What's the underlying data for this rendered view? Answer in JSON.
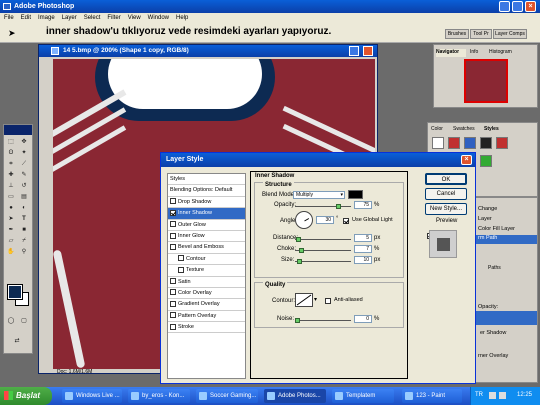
{
  "app": {
    "title": "Adobe Photoshop",
    "menu": [
      "File",
      "Edit",
      "Image",
      "Layer",
      "Select",
      "Filter",
      "View",
      "Window",
      "Help"
    ]
  },
  "annotation": "inner shadow'u tıklıyoruz vede resimdeki ayarları yapıyoruz.",
  "options_bar": {
    "tabs": [
      "Brushes",
      "Tool Pr",
      "Layer Comps"
    ]
  },
  "document": {
    "title": "14 5.bmp @ 200% (Shape 1 copy, RGB/8)",
    "status": "Doc: 1,6M/1,6M"
  },
  "navigator": {
    "tabs": [
      "Navigator",
      "Info",
      "Histogram"
    ]
  },
  "styles_panel": {
    "tabs": [
      "Color",
      "Swatches",
      "Styles"
    ]
  },
  "layers_side": {
    "items": [
      "Change",
      "Layer",
      "Color Fill Layer",
      "rm Path",
      "Paths",
      "Opacity:",
      "er Shadow",
      "rner Overlay"
    ]
  },
  "dialog": {
    "title": "Layer Style",
    "styles_header": "Styles",
    "styles_list": [
      {
        "label": "Blending Options: Default",
        "checkbox": false,
        "checked": false,
        "selected": false
      },
      {
        "label": "Drop Shadow",
        "checkbox": true,
        "checked": false,
        "selected": false
      },
      {
        "label": "Inner Shadow",
        "checkbox": true,
        "checked": true,
        "selected": true
      },
      {
        "label": "Outer Glow",
        "checkbox": true,
        "checked": false,
        "selected": false
      },
      {
        "label": "Inner Glow",
        "checkbox": true,
        "checked": false,
        "selected": false
      },
      {
        "label": "Bevel and Emboss",
        "checkbox": true,
        "checked": false,
        "selected": false
      },
      {
        "label": "Contour",
        "checkbox": true,
        "checked": false,
        "selected": false,
        "indent": true
      },
      {
        "label": "Texture",
        "checkbox": true,
        "checked": false,
        "selected": false,
        "indent": true
      },
      {
        "label": "Satin",
        "checkbox": true,
        "checked": false,
        "selected": false
      },
      {
        "label": "Color Overlay",
        "checkbox": true,
        "checked": false,
        "selected": false
      },
      {
        "label": "Gradient Overlay",
        "checkbox": true,
        "checked": false,
        "selected": false
      },
      {
        "label": "Pattern Overlay",
        "checkbox": true,
        "checked": false,
        "selected": false
      },
      {
        "label": "Stroke",
        "checkbox": true,
        "checked": false,
        "selected": false
      }
    ],
    "section_title": "Inner Shadow",
    "structure": {
      "label": "Structure",
      "blend_mode_label": "Blend Mode:",
      "blend_mode": "Multiply",
      "opacity_label": "Opacity:",
      "opacity": "75",
      "angle_label": "Angle:",
      "angle": "30",
      "global_light": "Use Global Light",
      "distance_label": "Distance:",
      "distance": "5",
      "choke_label": "Choke:",
      "choke": "7",
      "size_label": "Size:",
      "size": "10",
      "unit_pct": "%",
      "unit_px": "px",
      "deg": "°"
    },
    "quality": {
      "label": "Quality",
      "contour_label": "Contour:",
      "anti_aliased": "Anti-aliased",
      "noise_label": "Noise:",
      "noise": "0"
    },
    "buttons": {
      "ok": "OK",
      "cancel": "Cancel",
      "new_style": "New Style...",
      "preview": "Preview"
    }
  },
  "taskbar": {
    "start": "Başlat",
    "items": [
      "Windows Live ...",
      "by_eros - Kon...",
      "Soccer Gaming...",
      "Adobe Photos...",
      "Templatem",
      "123 - Paint"
    ],
    "lang": "TR",
    "clock": "12:25"
  },
  "colors": {
    "jersey": "#8a2733",
    "collar": "#0d2a52",
    "accent": "#316ac5"
  }
}
